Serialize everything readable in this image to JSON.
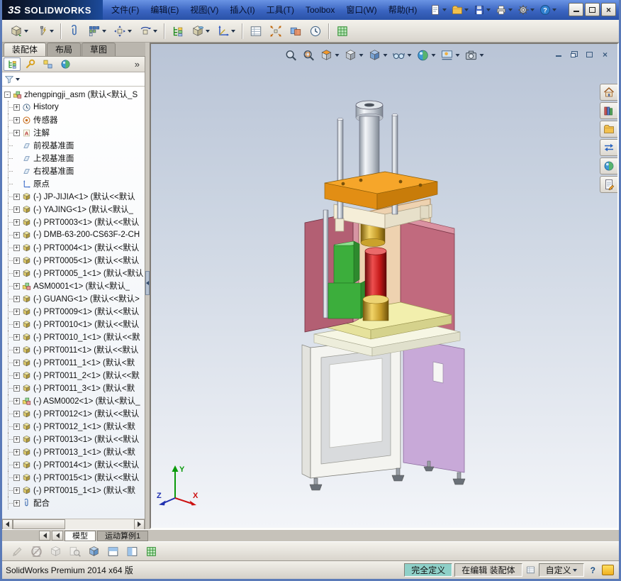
{
  "titlebar": {
    "logo_mark": "3S",
    "logo_text": "SOLIDWORKS",
    "menus": [
      "文件(F)",
      "编辑(E)",
      "视图(V)",
      "插入(I)",
      "工具(T)",
      "Toolbox",
      "窗口(W)",
      "帮助(H)"
    ],
    "quick_icons": [
      {
        "name": "new-document",
        "icon": "doc",
        "caret": true
      },
      {
        "name": "open-document",
        "icon": "folder",
        "caret": true
      },
      {
        "name": "save",
        "icon": "disk",
        "caret": true
      },
      {
        "name": "print",
        "icon": "printer",
        "caret": true
      },
      {
        "name": "options",
        "icon": "gear",
        "caret": true
      },
      {
        "name": "help",
        "icon": "help",
        "caret": true
      }
    ],
    "window_buttons": [
      {
        "name": "minimize-button",
        "glyph": "min"
      },
      {
        "name": "maximize-button",
        "glyph": "max"
      },
      {
        "name": "close-button",
        "glyph": "close"
      }
    ]
  },
  "toolbar": {
    "items": [
      {
        "name": "insert-components",
        "icon": "cubeg",
        "caret": true
      },
      {
        "name": "smart-fasteners",
        "icon": "fast",
        "caret": true
      },
      {
        "sep": true
      },
      {
        "name": "mate",
        "icon": "clip"
      },
      {
        "name": "linear-component-pattern",
        "icon": "pattern",
        "caret": true
      },
      {
        "name": "move-component",
        "icon": "move",
        "caret": true
      },
      {
        "name": "rotate-component",
        "icon": "rotate",
        "caret": true
      },
      {
        "sep": true
      },
      {
        "name": "show-hidden-components",
        "icon": "treeg"
      },
      {
        "name": "assembly-features",
        "icon": "feat",
        "caret": true
      },
      {
        "name": "reference-geometry",
        "icon": "axes",
        "caret": true
      },
      {
        "sep": true
      },
      {
        "name": "bill-of-materials",
        "icon": "bom"
      },
      {
        "name": "exploded-view",
        "icon": "explode"
      },
      {
        "name": "interference-detection",
        "icon": "interf"
      },
      {
        "name": "new-motion-study",
        "icon": "clock"
      },
      {
        "sep": true
      },
      {
        "name": "large-assembly-mode",
        "icon": "grid"
      }
    ]
  },
  "command_tabs": [
    {
      "label": "装配体",
      "active": true
    },
    {
      "label": "布局",
      "active": false
    },
    {
      "label": "草图",
      "active": false
    }
  ],
  "panel": {
    "tabs": [
      {
        "name": "featuremanager-tab",
        "icon": "treeg",
        "active": true
      },
      {
        "name": "propertymanager-tab",
        "icon": "prop",
        "active": false
      },
      {
        "name": "configurationmanager-tab",
        "icon": "config",
        "active": false
      },
      {
        "name": "displaymanager-tab",
        "icon": "ball",
        "active": false
      }
    ],
    "overflow_label": "»",
    "filter": {
      "name": "filter",
      "icon": "funnel"
    }
  },
  "tree": {
    "items": [
      {
        "icon": "asm",
        "exp": "minus",
        "indent": 0,
        "label": "zhengpingji_asm (默认<默认_S"
      },
      {
        "icon": "hist",
        "exp": "plus",
        "indent": 1,
        "label": "History"
      },
      {
        "icon": "sens",
        "exp": "plus",
        "indent": 1,
        "label": "传感器"
      },
      {
        "icon": "anno",
        "exp": "plus",
        "indent": 1,
        "label": "注解"
      },
      {
        "icon": "plane",
        "exp": "none",
        "indent": 1,
        "label": "前视基准面"
      },
      {
        "icon": "plane",
        "exp": "none",
        "indent": 1,
        "label": "上视基准面"
      },
      {
        "icon": "plane",
        "exp": "none",
        "indent": 1,
        "label": "右视基准面"
      },
      {
        "icon": "origin",
        "exp": "none",
        "indent": 1,
        "label": "原点"
      },
      {
        "icon": "part",
        "exp": "plus",
        "indent": 1,
        "label": "(-) JP-JIJIA<1> (默认<<默认"
      },
      {
        "icon": "part",
        "exp": "plus",
        "indent": 1,
        "label": "(-) YAJING<1> (默认<默认_"
      },
      {
        "icon": "part",
        "exp": "plus",
        "indent": 1,
        "label": "(-) PRT0003<1> (默认<<默认"
      },
      {
        "icon": "part",
        "exp": "plus",
        "indent": 1,
        "label": "(-) DMB-63-200-CS63F-2-CH"
      },
      {
        "icon": "part",
        "exp": "plus",
        "indent": 1,
        "label": "(-) PRT0004<1> (默认<<默认"
      },
      {
        "icon": "part",
        "exp": "plus",
        "indent": 1,
        "label": "(-) PRT0005<1> (默认<<默认"
      },
      {
        "icon": "part",
        "exp": "plus",
        "indent": 1,
        "label": "(-) PRT0005_1<1> (默认<默认"
      },
      {
        "icon": "asm",
        "exp": "plus",
        "indent": 1,
        "label": "ASM0001<1> (默认<默认_"
      },
      {
        "icon": "part",
        "exp": "plus",
        "indent": 1,
        "label": "(-) GUANG<1> (默认<<默认>"
      },
      {
        "icon": "part",
        "exp": "plus",
        "indent": 1,
        "label": "(-) PRT0009<1> (默认<<默认"
      },
      {
        "icon": "part",
        "exp": "plus",
        "indent": 1,
        "label": "(-) PRT0010<1> (默认<<默认"
      },
      {
        "icon": "part",
        "exp": "plus",
        "indent": 1,
        "label": "(-) PRT0010_1<1> (默认<<默"
      },
      {
        "icon": "part",
        "exp": "plus",
        "indent": 1,
        "label": "(-) PRT0011<1> (默认<<默认"
      },
      {
        "icon": "part",
        "exp": "plus",
        "indent": 1,
        "label": "(-) PRT0011_1<1> (默认<默"
      },
      {
        "icon": "part",
        "exp": "plus",
        "indent": 1,
        "label": "(-) PRT0011_2<1> (默认<<默"
      },
      {
        "icon": "part",
        "exp": "plus",
        "indent": 1,
        "label": "(-) PRT0011_3<1> (默认<默"
      },
      {
        "icon": "asm",
        "exp": "plus",
        "indent": 1,
        "label": "(-) ASM0002<1> (默认<默认_"
      },
      {
        "icon": "part",
        "exp": "plus",
        "indent": 1,
        "label": "(-) PRT0012<1> (默认<<默认"
      },
      {
        "icon": "part",
        "exp": "plus",
        "indent": 1,
        "label": "(-) PRT0012_1<1> (默认<默"
      },
      {
        "icon": "part",
        "exp": "plus",
        "indent": 1,
        "label": "(-) PRT0013<1> (默认<<默认"
      },
      {
        "icon": "part",
        "exp": "plus",
        "indent": 1,
        "label": "(-) PRT0013_1<1> (默认<默"
      },
      {
        "icon": "part",
        "exp": "plus",
        "indent": 1,
        "label": "(-) PRT0014<1> (默认<<默认"
      },
      {
        "icon": "part",
        "exp": "plus",
        "indent": 1,
        "label": "(-) PRT0015<1> (默认<<默认"
      },
      {
        "icon": "part",
        "exp": "plus",
        "indent": 1,
        "label": "(-) PRT0015_1<1> (默认<默"
      },
      {
        "icon": "mates",
        "exp": "plus",
        "indent": 1,
        "label": "配合"
      }
    ]
  },
  "viewport": {
    "headsup": [
      {
        "name": "zoom-fit",
        "icon": "mag",
        "caret": false
      },
      {
        "name": "zoom-to-area",
        "icon": "magp",
        "caret": false
      },
      {
        "name": "section-view",
        "icon": "section",
        "caret": true
      },
      {
        "name": "view-orientation",
        "icon": "vcube",
        "caret": true
      },
      {
        "name": "display-style",
        "icon": "dstyle",
        "caret": true
      },
      {
        "name": "hide-show-items",
        "icon": "glasses",
        "caret": true
      },
      {
        "name": "edit-appearance",
        "icon": "ball",
        "caret": true
      },
      {
        "name": "apply-scene",
        "icon": "scene",
        "caret": true
      },
      {
        "name": "view-settings",
        "icon": "camera",
        "caret": true
      }
    ],
    "doc_controls": [
      {
        "name": "doc-minimize-button",
        "glyph": "min"
      },
      {
        "name": "doc-restore-button",
        "glyph": "rest"
      },
      {
        "name": "doc-maximize-button",
        "glyph": "max"
      },
      {
        "name": "doc-close-button",
        "glyph": "close"
      }
    ],
    "task_pane": [
      {
        "name": "solidworks-resources",
        "icon": "house"
      },
      {
        "name": "design-library",
        "icon": "books"
      },
      {
        "name": "file-explorer",
        "icon": "folder"
      },
      {
        "name": "view-palette",
        "icon": "palette"
      },
      {
        "name": "appearances-scenes",
        "icon": "ball"
      },
      {
        "name": "custom-properties",
        "icon": "docpen"
      }
    ],
    "triad": {
      "x": "X",
      "y": "Y",
      "z": "Z"
    }
  },
  "bottom_tabs": {
    "tabs": [
      {
        "label": "模型",
        "active": true
      },
      {
        "label": "运动算例1",
        "active": false
      }
    ]
  },
  "bottom_toolbar": {
    "items": [
      {
        "name": "edit-component",
        "icon": "pencil",
        "disabled": true
      },
      {
        "name": "no-external-references",
        "icon": "noref",
        "disabled": true
      },
      {
        "name": "isolate",
        "icon": "iso",
        "disabled": true
      },
      {
        "name": "large-design-review",
        "icon": "ldr",
        "disabled": true
      },
      {
        "name": "assembly-visualization",
        "icon": "cubeb",
        "disabled": false
      },
      {
        "name": "split-pane-horizontal",
        "icon": "paneh",
        "disabled": false
      },
      {
        "name": "split-pane-vertical",
        "icon": "panev",
        "disabled": false
      },
      {
        "name": "grid-system",
        "icon": "grid",
        "disabled": false
      }
    ]
  },
  "statusbar": {
    "product": "SolidWorks Premium 2014 x64 版",
    "defined_state": "完全定义",
    "editing_state": "在编辑 装配体",
    "units": "自定义",
    "help_label": "?"
  }
}
